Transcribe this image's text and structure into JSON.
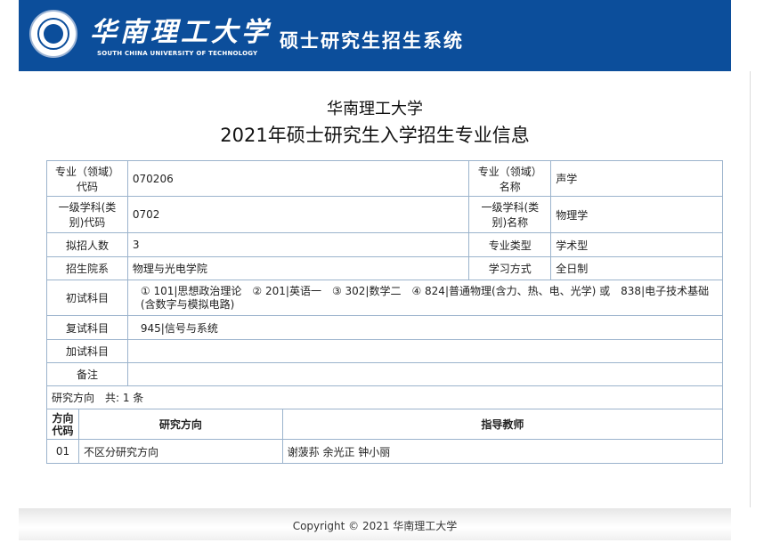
{
  "header": {
    "university_cn": "华南理工大学",
    "university_en": "SOUTH CHINA UNIVERSITY OF TECHNOLOGY",
    "system_title": "硕士研究生招生系统",
    "brand_color": "#0c4e9b"
  },
  "page": {
    "school": "华南理工大学",
    "title": "2021年硕士研究生入学招生专业信息"
  },
  "info": {
    "major_code_label": "专业（领域）代码",
    "major_code": "070206",
    "major_name_label": "专业（领域）名称",
    "major_name": "声学",
    "discipline_code_label": "一级学科(类别)代码",
    "discipline_code": "0702",
    "discipline_name_label": "一级学科(类别)名称",
    "discipline_name": "物理学",
    "quota_label": "拟招人数",
    "quota": "3",
    "major_type_label": "专业类型",
    "major_type": "学术型",
    "school_label": "招生院系",
    "school": "物理与光电学院",
    "study_mode_label": "学习方式",
    "study_mode": "全日制",
    "prelim_label": "初试科目",
    "prelim": "① 101|思想政治理论　② 201|英语一　③ 302|数学二　④ 824|普通物理(含力、热、电、光学) 或　838|电子技术基础(含数字与模拟电路)",
    "retest_label": "复试科目",
    "retest": "945|信号与系统",
    "extra_label": "加试科目",
    "extra": "",
    "remark_label": "备注",
    "remark": "",
    "directions_count": "研究方向　共: 1 条"
  },
  "directions": {
    "headers": {
      "code": "方向代码",
      "name": "研究方向",
      "advisors": "指导教师"
    },
    "rows": [
      {
        "code": "01",
        "name": "不区分研究方向",
        "advisors": "谢菠荪 余光正 钟小丽"
      }
    ]
  },
  "footer": {
    "copyright": "Copyright © 2021 华南理工大学"
  }
}
